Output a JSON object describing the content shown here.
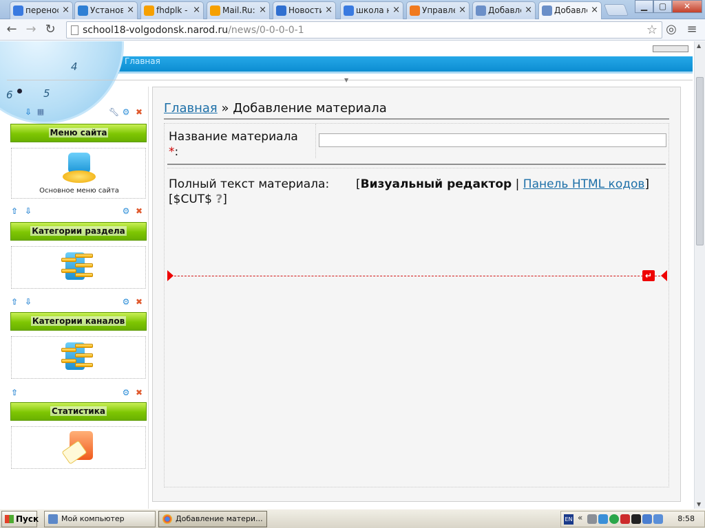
{
  "tabs": [
    {
      "title": "перенос",
      "favicon": "google-icon",
      "color": "#3a7ae0"
    },
    {
      "title": "Установ",
      "favicon": "chrome-web-icon",
      "color": "#2f7fd4"
    },
    {
      "title": "fhdplk - ",
      "favicon": "mail-ru-icon",
      "color": "#f6a000"
    },
    {
      "title": "Mail.Ru:",
      "favicon": "mail-ru-icon",
      "color": "#f6a000"
    },
    {
      "title": "Новости",
      "favicon": "s-logo-icon",
      "color": "#2f6fd0"
    },
    {
      "title": "школа н",
      "favicon": "google-icon",
      "color": "#3a7ae0"
    },
    {
      "title": "Управле",
      "favicon": "ucoz-icon",
      "color": "#f07a20"
    },
    {
      "title": "Добавле",
      "favicon": "ucoz-blue-icon",
      "color": "#6b8fc8"
    },
    {
      "title": "Добавле",
      "favicon": "ucoz-blue-icon",
      "color": "#6b8fc8",
      "active": true
    }
  ],
  "window": {
    "minimize": "▁",
    "maximize": "▢",
    "close": "✕"
  },
  "omnibox": {
    "host": "school18-volgodonsk.narod.ru",
    "path": "/news/0-0-0-0-1"
  },
  "site": {
    "nav_home": "Главная"
  },
  "clock": {
    "four": "4",
    "six": "6",
    "five": "5"
  },
  "sidebar": {
    "blocks": [
      {
        "title": "Меню сайта",
        "caption": "Основное меню сайта"
      },
      {
        "title": "Категории раздела"
      },
      {
        "title": "Категории каналов"
      },
      {
        "title": "Статистика"
      }
    ]
  },
  "main": {
    "breadcrumb_home": "Главная",
    "breadcrumb_sep": " » ",
    "breadcrumb_current": "Добавление материала",
    "title_label": "Название материала",
    "required_mark": "*",
    "title_colon": ":",
    "title_value": "",
    "fulltext_label": "Полный текст материала:",
    "bracket_open": "[",
    "visual_editor": "Визуальный редактор",
    "pipe": " | ",
    "html_panel": "Панель HTML кодов",
    "bracket_close": "]",
    "cut_prefix": "[$CUT$ ",
    "cut_help": "?",
    "cut_suffix": "]"
  },
  "taskbar": {
    "start": "Пуск",
    "items": [
      {
        "label": "Мой компьютер"
      },
      {
        "label": "Добавление матери...",
        "active": true
      }
    ],
    "lang": "EN",
    "chevron": "«",
    "time": "8:58"
  }
}
